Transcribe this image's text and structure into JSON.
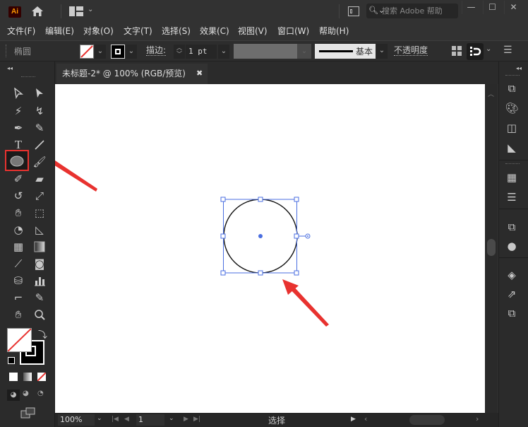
{
  "app": {
    "logo": "Ai",
    "search_placeholder": "搜索 Adobe 帮助",
    "window_controls": {
      "minimize": "—",
      "maximize": "☐",
      "close": "✕"
    }
  },
  "menu": [
    "文件(F)",
    "编辑(E)",
    "对象(O)",
    "文字(T)",
    "选择(S)",
    "效果(C)",
    "视图(V)",
    "窗口(W)",
    "帮助(H)"
  ],
  "control_bar": {
    "selection_label": "椭圆",
    "fill": "none",
    "stroke_color": "#000000",
    "stroke_label": "描边",
    "stroke_weight": "1 pt",
    "profile_label": "基本",
    "opacity_label": "不透明度"
  },
  "document": {
    "tab_title": "未标题-2* @ 100% (RGB/预览)",
    "close": "✖"
  },
  "tools": {
    "rows": [
      [
        "selection-tool",
        "direct-selection-tool"
      ],
      [
        "magic-wand-tool",
        "lasso-tool"
      ],
      [
        "pen-tool",
        "curvature-tool"
      ],
      [
        "type-tool",
        "line-segment-tool"
      ],
      [
        "ellipse-tool",
        "paintbrush-tool"
      ],
      [
        "shaper-tool",
        "eraser-tool"
      ],
      [
        "rotate-tool",
        "scale-tool"
      ],
      [
        "puppet-warp-tool",
        "free-transform-tool"
      ],
      [
        "shape-builder-tool",
        "perspective-grid-tool"
      ],
      [
        "mesh-tool",
        "gradient-tool"
      ],
      [
        "eyedropper-tool",
        "blend-tool"
      ],
      [
        "symbol-sprayer-tool",
        "column-graph-tool"
      ],
      [
        "artboard-tool",
        "slice-tool"
      ],
      [
        "hand-tool",
        "zoom-tool"
      ]
    ],
    "active": "ellipse-tool"
  },
  "colors": {
    "accent_red": "#e8322f",
    "selection_blue": "#4a6ee0",
    "canvas": "#ffffff",
    "ui_bg": "#323232"
  },
  "right_panel_icons": [
    "transform-icon",
    "color-icon",
    "appearance-icon",
    "color-guide-icon",
    "swatches-icon",
    "stroke-icon",
    "pathfinder-icon",
    "transparency-icon",
    "layers-icon",
    "export-icon",
    "artboards-icon"
  ],
  "status": {
    "zoom": "100%",
    "artboard": "1",
    "tool_status": "选择"
  }
}
